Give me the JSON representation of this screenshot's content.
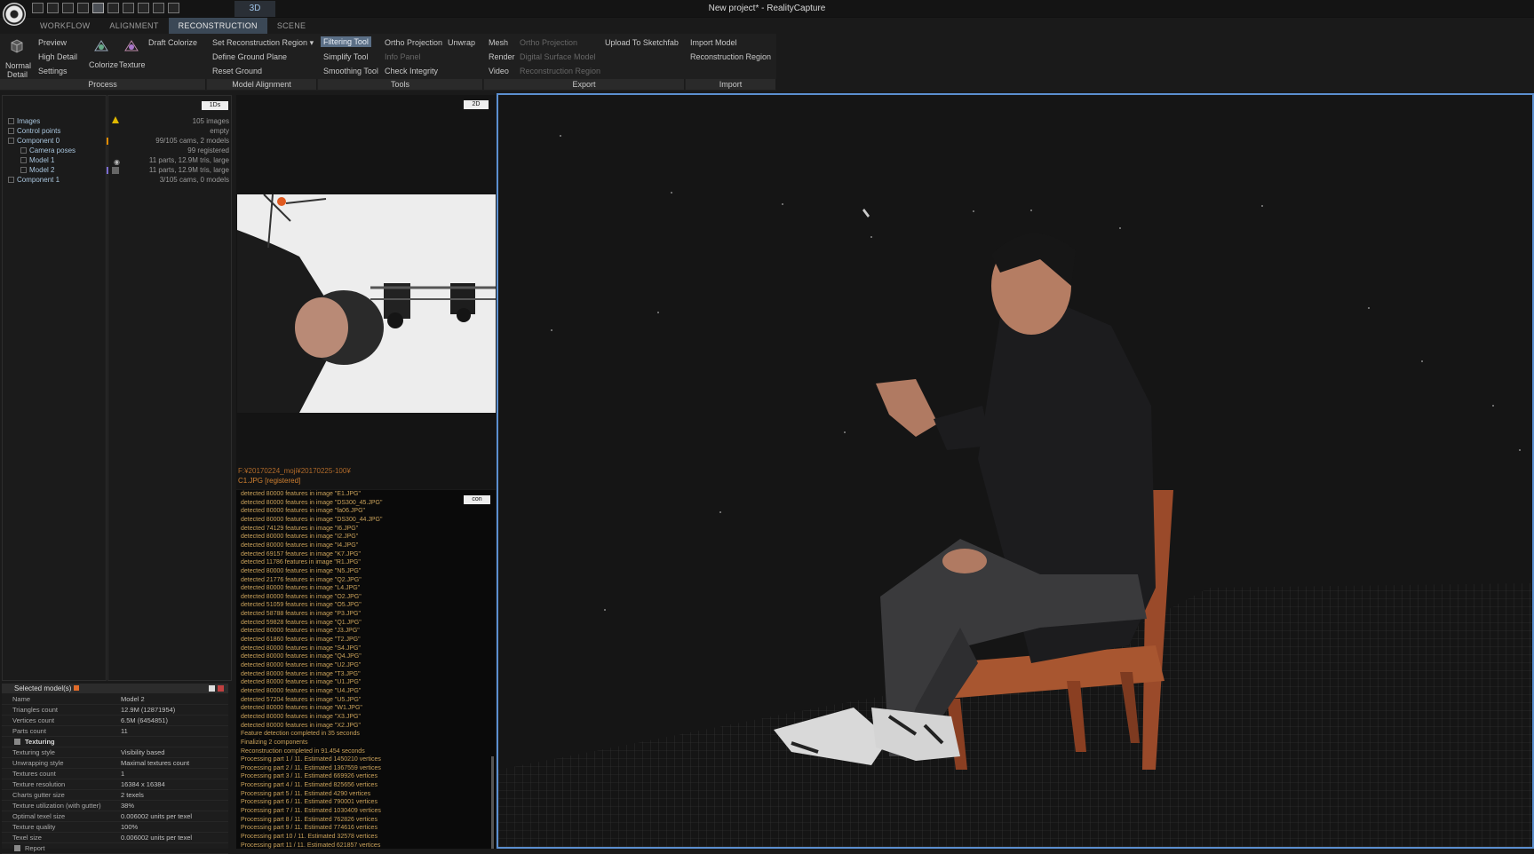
{
  "window": {
    "title": "New project* - RealityCapture"
  },
  "topbar": {
    "view_tab": "3D"
  },
  "tabs": [
    "WORKFLOW",
    "ALIGNMENT",
    "RECONSTRUCTION",
    "SCENE"
  ],
  "ribbon": {
    "normal": "Normal",
    "detail": "Detail",
    "preview": "Preview",
    "high_detail": "High Detail",
    "settings": "Settings",
    "colorize": "Colorize",
    "texture": "Texture",
    "draft_colorize": "Draft Colorize",
    "set_region": "Set Reconstruction Region",
    "define_ground": "Define Ground Plane",
    "reset_ground": "Reset Ground",
    "filtering": "Filtering Tool",
    "simplify": "Simplify Tool",
    "smoothing": "Smoothing Tool",
    "ortho": "Ortho Projection",
    "unwrap": "Unwrap",
    "info_panel": "Info Panel",
    "check_integrity": "Check Integrity",
    "mesh": "Mesh",
    "render": "Render",
    "video": "Video",
    "ortho_export": "Ortho Projection",
    "dsm": "Digital Surface Model",
    "recon_region": "Reconstruction Region",
    "sketchfab": "Upload To Sketchfab",
    "import_model": "Import Model",
    "import_region": "Reconstruction Region",
    "groups": [
      "Process",
      "Model Alignment",
      "Tools",
      "Export",
      "Import"
    ]
  },
  "panels": {
    "layout_1ds": "1Ds",
    "badge_2d": "2D",
    "console_btn": "con"
  },
  "tree": [
    {
      "label": "Images",
      "value": "105 images"
    },
    {
      "label": "Control points",
      "value": "empty"
    },
    {
      "label": "Component 0",
      "value": "99/105 cams, 2 models"
    },
    {
      "label": "Camera poses",
      "value": "99 registered"
    },
    {
      "label": "Model 1",
      "value": "11 parts, 12.9M tris, large"
    },
    {
      "label": "Model 2",
      "value": "11 parts, 12.9M tris, large"
    },
    {
      "label": "Component 1",
      "value": "3/105 cams, 0 models"
    }
  ],
  "image_path": "F:¥20170224_moji¥20170225-100¥",
  "image_name": "C1.JPG [registered]",
  "log": [
    "detected 80000 features in image \"E1.JPG\"",
    "detected 80000 features in image \"DS300_45.JPG\"",
    "detected 80000 features in image \"fa06.JPG\"",
    "detected 80000 features in image \"DS300_44.JPG\"",
    "detected 74129 features in image \"I6.JPG\"",
    "detected 80000 features in image \"I2.JPG\"",
    "detected 80000 features in image \"I4.JPG\"",
    "detected 69157 features in image \"K7.JPG\"",
    "detected 11786 features in image \"R1.JPG\"",
    "detected 80000 features in image \"N5.JPG\"",
    "detected 21776 features in image \"Q2.JPG\"",
    "detected 80000 features in image \"L4.JPG\"",
    "detected 80000 features in image \"O2.JPG\"",
    "detected 51059 features in image \"O5.JPG\"",
    "detected 58788 features in image \"P3.JPG\"",
    "detected 59828 features in image \"Q1.JPG\"",
    "detected 80000 features in image \"J3.JPG\"",
    "detected 61860 features in image \"T2.JPG\"",
    "detected 80000 features in image \"S4.JPG\"",
    "detected 80000 features in image \"Q4.JPG\"",
    "detected 80000 features in image \"U2.JPG\"",
    "detected 80000 features in image \"T3.JPG\"",
    "detected 80000 features in image \"U1.JPG\"",
    "detected 80000 features in image \"U4.JPG\"",
    "detected 57204 features in image \"U5.JPG\"",
    "detected 80000 features in image \"W1.JPG\"",
    "detected 80000 features in image \"X3.JPG\"",
    "detected 80000 features in image \"X2.JPG\"",
    "Feature detection completed in 35 seconds",
    "Finalizing 2 components",
    "Reconstruction completed in 91.454 seconds",
    "Processing part 1 / 11. Estimated 1450210 vertices",
    "Processing part 2 / 11. Estimated 1367559 vertices",
    "Processing part 3 / 11. Estimated 669926 vertices",
    "Processing part 4 / 11. Estimated 825656 vertices",
    "Processing part 5 / 11. Estimated 4290 vertices",
    "Processing part 6 / 11. Estimated 790001 vertices",
    "Processing part 7 / 11. Estimated 1030409 vertices",
    "Processing part 8 / 11. Estimated 762826 vertices",
    "Processing part 9 / 11. Estimated 774616 vertices",
    "Processing part 10 / 11. Estimated 32578 vertices",
    "Processing part 11 / 11. Estimated 621857 vertices"
  ],
  "props": {
    "title": "Selected model(s)",
    "section_texturing": "Texturing",
    "section_report": "Report",
    "rows": [
      [
        "Name",
        "Model 2"
      ],
      [
        "Triangles count",
        "12.9M (12871954)"
      ],
      [
        "Vertices count",
        "6.5M (6454851)"
      ],
      [
        "Parts count",
        "11"
      ]
    ],
    "texturing_rows": [
      [
        "Texturing style",
        "Visibility based"
      ],
      [
        "Unwrapping style",
        "Maximal textures count"
      ],
      [
        "Textures count",
        "1"
      ],
      [
        "Texture resolution",
        "16384 x 16384"
      ],
      [
        "Charts gutter size",
        "2 texels"
      ],
      [
        "Texture utilization (with gutter)",
        "38%"
      ],
      [
        "Optimal texel size",
        "0.006002 units per texel"
      ],
      [
        "Texture quality",
        "100%"
      ],
      [
        "Texel size",
        "0.006002 units per texel"
      ]
    ]
  }
}
